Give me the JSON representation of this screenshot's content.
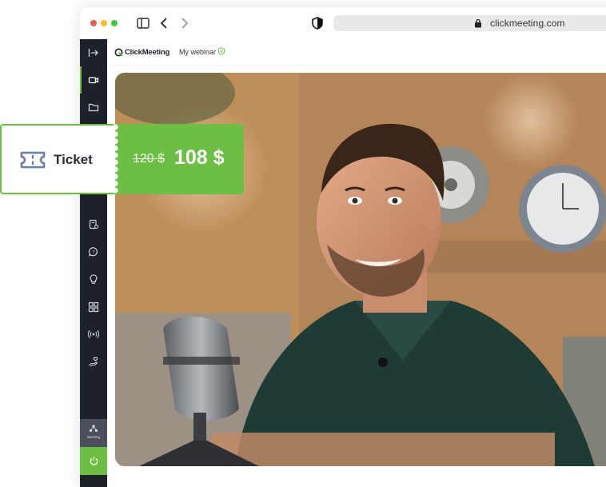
{
  "browser": {
    "url": "clickmeeting.com"
  },
  "app": {
    "logo_text": "ClickMeeting",
    "webinar_name": "My webinar",
    "meeting_label": "Meeting",
    "brand_color": "#6cbe45",
    "sidebar_color": "#1d2129"
  },
  "sidebar": {
    "items": [
      {
        "icon": "collapse-arrow-icon"
      },
      {
        "icon": "video-camera-icon"
      },
      {
        "icon": "folder-icon"
      },
      {
        "icon": "hidden-icon"
      },
      {
        "icon": "hidden-icon"
      },
      {
        "icon": "clipboard-gear-icon"
      },
      {
        "icon": "question-bubble-icon"
      },
      {
        "icon": "lightbulb-icon"
      },
      {
        "icon": "apps-grid-icon"
      },
      {
        "icon": "broadcast-icon"
      },
      {
        "icon": "hand-heart-icon"
      }
    ]
  },
  "ticket": {
    "label": "Ticket",
    "old_price": "120 $",
    "new_price": "108 $"
  }
}
